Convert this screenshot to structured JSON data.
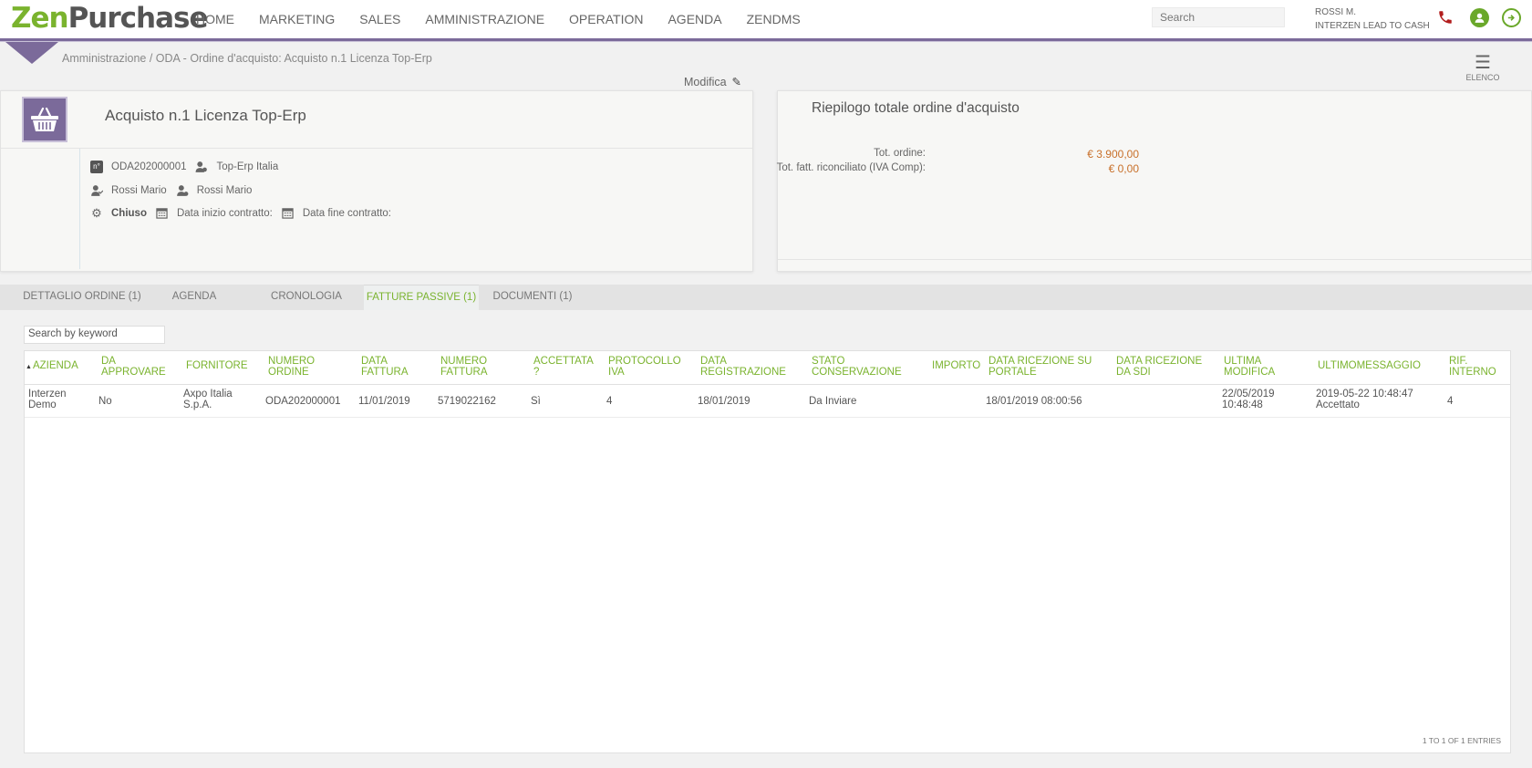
{
  "app": {
    "logo_zen": "Zen",
    "logo_purchase": "Purchase"
  },
  "nav": [
    "HOME",
    "MARKETING",
    "SALES",
    "AMMINISTRAZIONE",
    "OPERATION",
    "AGENDA",
    "ZENDMS"
  ],
  "search": {
    "placeholder": "Search"
  },
  "user": {
    "name": "ROSSI M.",
    "company": "INTERZEN LEAD TO CASH"
  },
  "breadcrumb": "Amministrazione / ODA - Ordine d'acquisto: Acquisto n.1 Licenza Top-Erp",
  "list_button": "ELENCO",
  "edit_label": "Modifica",
  "order": {
    "title": "Acquisto n.1 Licenza Top-Erp",
    "code": "ODA202000001",
    "supplier": "Top-Erp Italia",
    "owner1": "Rossi Mario",
    "owner2": "Rossi Mario",
    "status": "Chiuso",
    "start_label": "Data inizio contratto:",
    "end_label": "Data fine contratto:"
  },
  "summary": {
    "title": "Riepilogo totale ordine d'acquisto",
    "tot_label": "Tot. ordine:",
    "tot_value": "€ 3.900,00",
    "fatt_label": "Tot. fatt. riconciliato (IVA Comp):",
    "fatt_value": "€ 0,00"
  },
  "tabs": [
    "DETTAGLIO ORDINE (1)",
    "AGENDA",
    "CRONOLOGIA",
    "FATTURE PASSIVE (1)",
    "DOCUMENTI (1)"
  ],
  "keyword_placeholder": "Search by keyword",
  "table": {
    "headers": [
      [
        "AZIENDA",
        ""
      ],
      [
        "DA",
        "APPROVARE"
      ],
      [
        "FORNITORE",
        ""
      ],
      [
        "NUMERO",
        "ORDINE"
      ],
      [
        "DATA",
        "FATTURA"
      ],
      [
        "NUMERO",
        "FATTURA"
      ],
      [
        "ACCETTATA",
        "?"
      ],
      [
        "PROTOCOLLO",
        "IVA"
      ],
      [
        "DATA",
        "REGISTRAZIONE"
      ],
      [
        "STATO",
        "CONSERVAZIONE"
      ],
      [
        "IMPORTO",
        ""
      ],
      [
        "DATA RICEZIONE SU",
        "PORTALE"
      ],
      [
        "DATA RICEZIONE",
        "DA SDI"
      ],
      [
        "ULTIMA",
        "MODIFICA"
      ],
      [
        "ULTIMOMESSAGGIO",
        ""
      ],
      [
        "RIF.",
        "INTERNO"
      ]
    ],
    "row": [
      [
        "Interzen",
        "Demo"
      ],
      [
        "No",
        ""
      ],
      [
        "Axpo Italia",
        "S.p.A."
      ],
      [
        "ODA202000001",
        ""
      ],
      [
        "11/01/2019",
        ""
      ],
      [
        "5719022162",
        ""
      ],
      [
        "Sì",
        ""
      ],
      [
        "4",
        ""
      ],
      [
        "18/01/2019",
        ""
      ],
      [
        "Da Inviare",
        ""
      ],
      [
        "",
        ""
      ],
      [
        "18/01/2019 08:00:56",
        ""
      ],
      [
        "",
        ""
      ],
      [
        "22/05/2019",
        "10:48:48"
      ],
      [
        "2019-05-22 10:48:47",
        "Accettato"
      ],
      [
        "4",
        ""
      ]
    ],
    "entries": "1 TO 1 OF 1 ENTRIES"
  },
  "colors": {
    "accent_green": "#7ab32e",
    "brand_purple": "#7b6a9a",
    "amount_orange": "#c8702a"
  }
}
